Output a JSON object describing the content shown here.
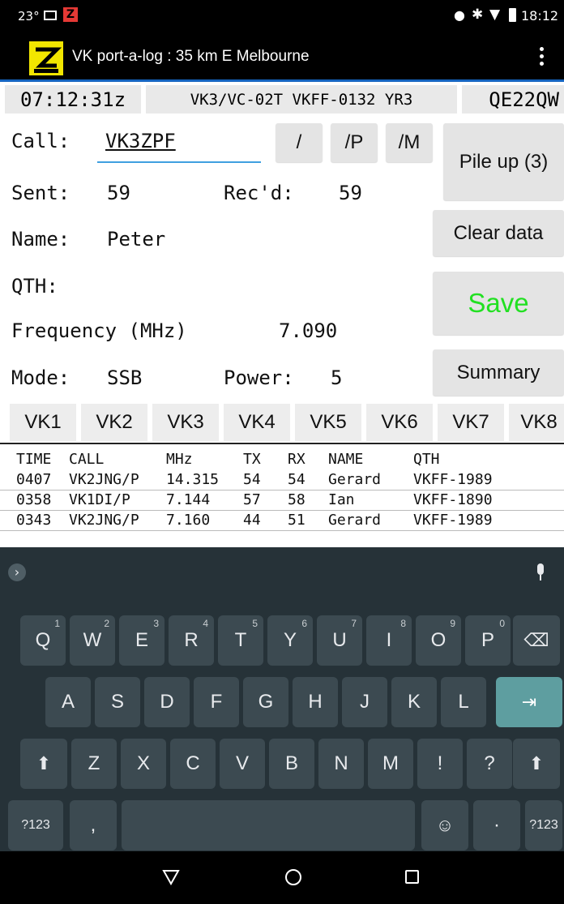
{
  "status_bar": {
    "temperature": "23°",
    "time": "18:12"
  },
  "app_bar": {
    "title": "VK port-a-log : 35 km E Melbourne"
  },
  "info_bar": {
    "utc_time": "07:12:31z",
    "station_ref": "VK3/VC-02T VKFF-0132 YR3",
    "locator": "QE22QW"
  },
  "form": {
    "call_label": "Call:",
    "call_value": "VK3ZPF",
    "suffix_slash": "/",
    "suffix_p": "/P",
    "suffix_m": "/M",
    "pileup_button": "Pile up (3)",
    "sent_label": "Sent:",
    "sent_value": "59",
    "recd_label": "Rec'd:",
    "recd_value": "59",
    "clear_button": "Clear data",
    "name_label": "Name:",
    "name_value": "Peter",
    "qth_label": "QTH:",
    "qth_value": "",
    "save_button": "Save",
    "freq_label": "Frequency (MHz)",
    "freq_value": "7.090",
    "mode_label": "Mode:",
    "mode_value": "SSB",
    "power_label": "Power:",
    "power_value": "5",
    "summary_button": "Summary"
  },
  "tabs": [
    "VK1",
    "VK2",
    "VK3",
    "VK4",
    "VK5",
    "VK6",
    "VK7",
    "VK8"
  ],
  "log": {
    "headers": {
      "time": "TIME",
      "call": "CALL",
      "mhz": "MHz",
      "tx": "TX",
      "rx": "RX",
      "name": "NAME",
      "qth": "QTH"
    },
    "rows": [
      {
        "time": "0407",
        "call": "VK2JNG/P",
        "mhz": "14.315",
        "tx": "54",
        "rx": "54",
        "name": "Gerard",
        "qth": "VKFF-1989"
      },
      {
        "time": "0358",
        "call": "VK1DI/P",
        "mhz": "7.144",
        "tx": "57",
        "rx": "58",
        "name": "Ian",
        "qth": "VKFF-1890"
      },
      {
        "time": "0343",
        "call": "VK2JNG/P",
        "mhz": "7.160",
        "tx": "44",
        "rx": "51",
        "name": "Gerard",
        "qth": "VKFF-1989"
      }
    ]
  },
  "keyboard": {
    "row1": [
      {
        "k": "Q",
        "h": "1"
      },
      {
        "k": "W",
        "h": "2"
      },
      {
        "k": "E",
        "h": "3"
      },
      {
        "k": "R",
        "h": "4"
      },
      {
        "k": "T",
        "h": "5"
      },
      {
        "k": "Y",
        "h": "6"
      },
      {
        "k": "U",
        "h": "7"
      },
      {
        "k": "I",
        "h": "8"
      },
      {
        "k": "O",
        "h": "9"
      },
      {
        "k": "P",
        "h": "0"
      }
    ],
    "row2": [
      "A",
      "S",
      "D",
      "F",
      "G",
      "H",
      "J",
      "K",
      "L"
    ],
    "row3": [
      "Z",
      "X",
      "C",
      "V",
      "B",
      "N",
      "M",
      "!",
      "?"
    ],
    "symbols_left": "?123",
    "comma": ",",
    "period": "·",
    "symbols_right": "?123",
    "accent_color": "#5e9ea0"
  }
}
